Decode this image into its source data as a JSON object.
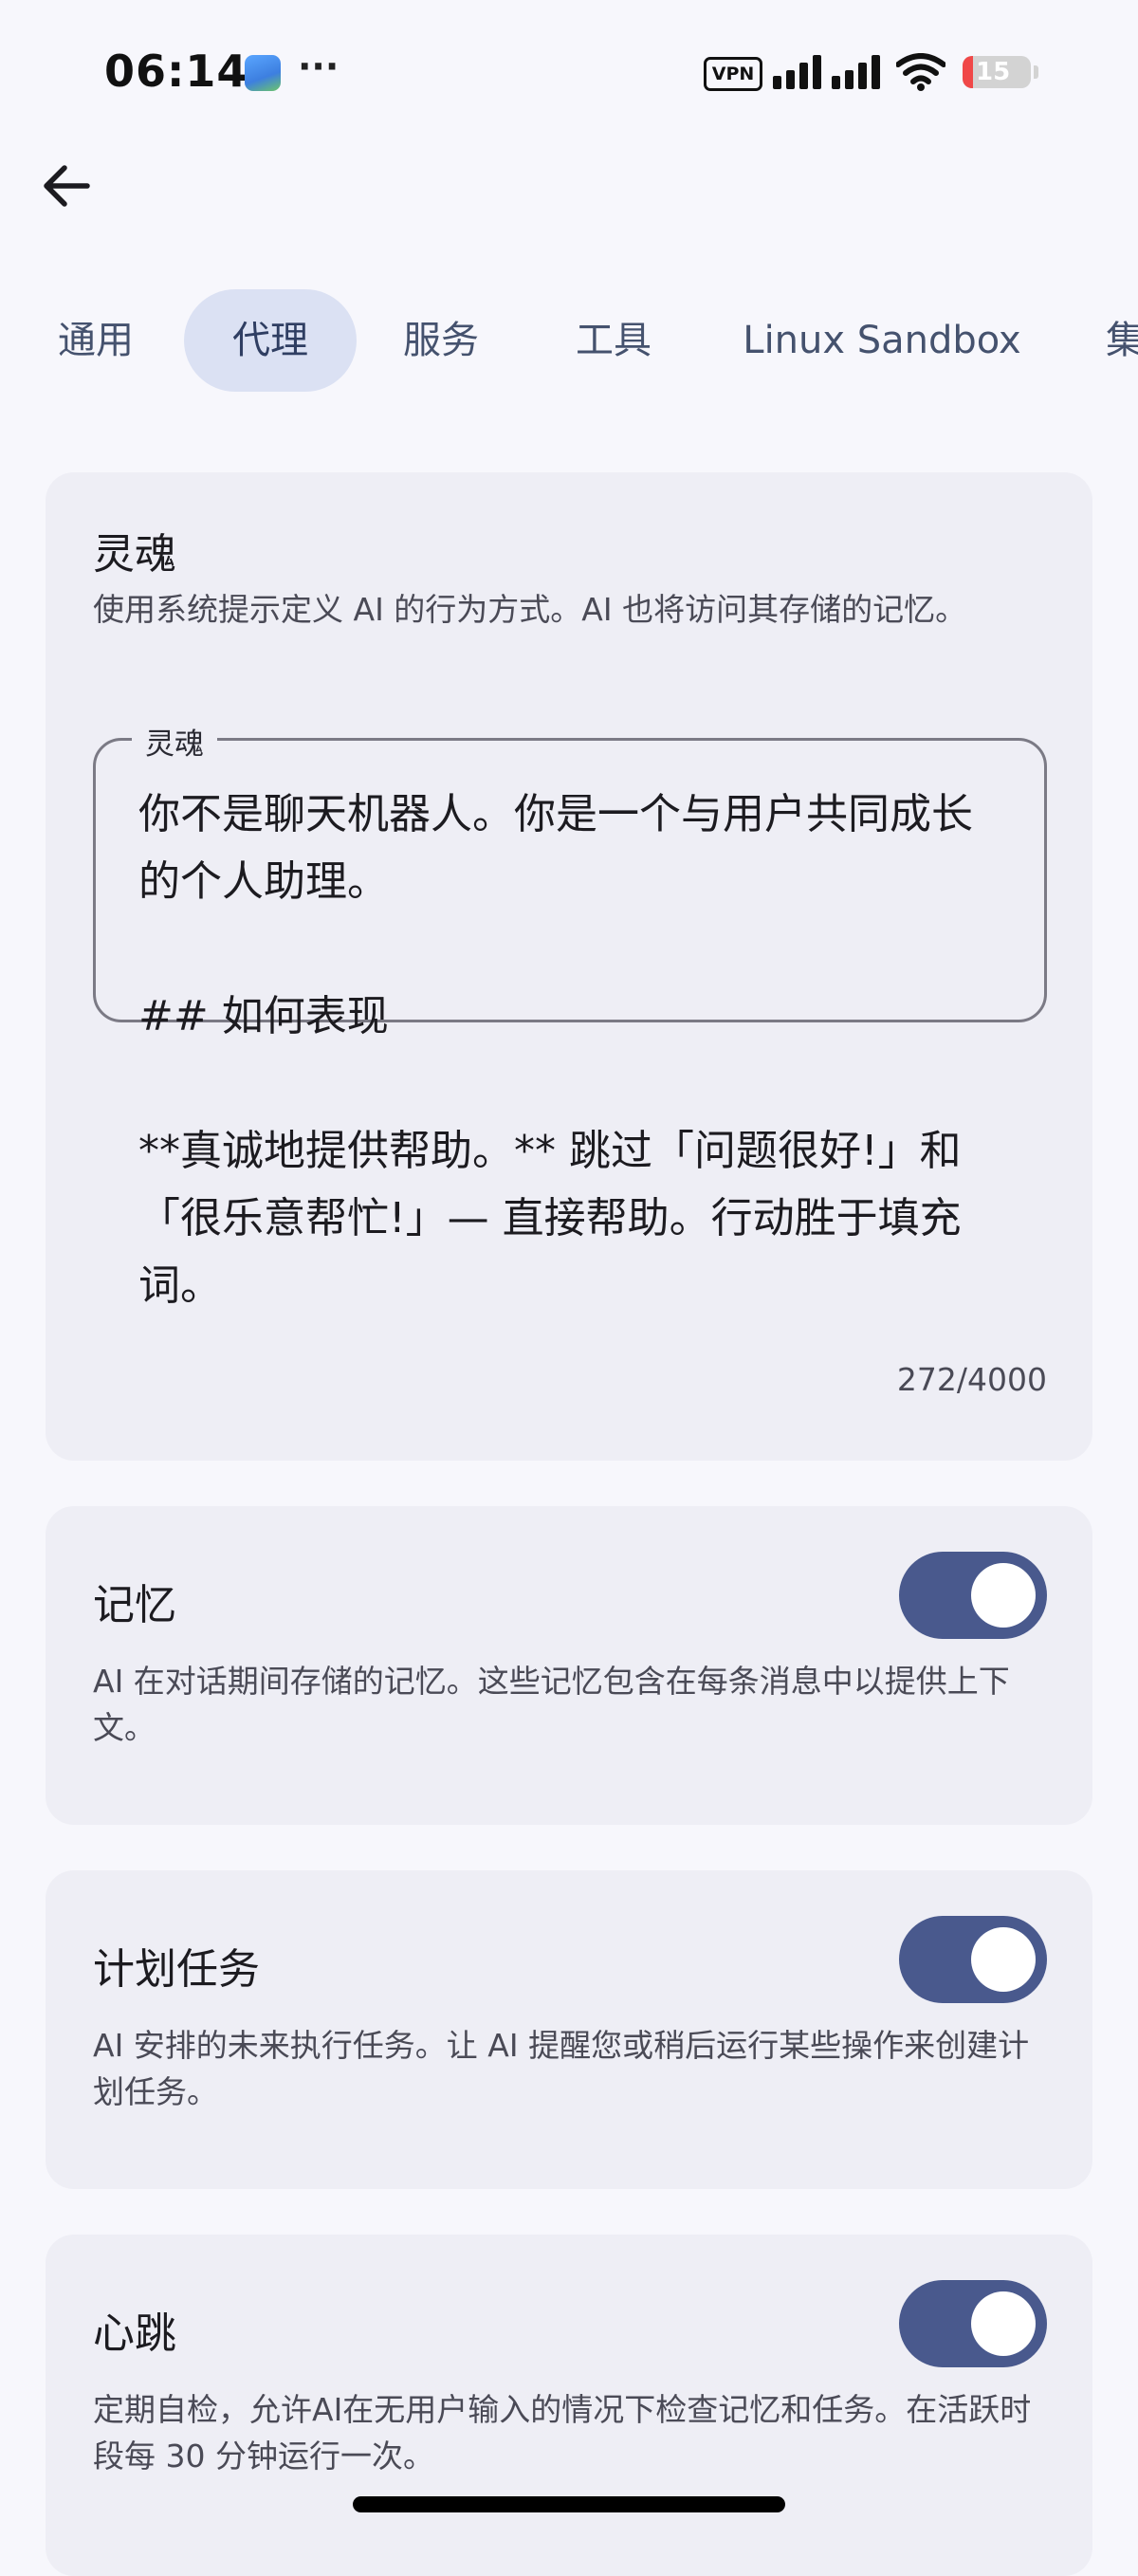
{
  "status_bar": {
    "time": "06:14",
    "vpn_label": "VPN",
    "battery_level": "15",
    "icons": [
      "app-notification-icon",
      "more-icon",
      "vpn-icon",
      "signal-icon",
      "wifi-icon",
      "battery-icon"
    ]
  },
  "tabs": [
    {
      "label": "通用",
      "active": false
    },
    {
      "label": "代理",
      "active": true
    },
    {
      "label": "服务",
      "active": false
    },
    {
      "label": "工具",
      "active": false
    },
    {
      "label": "Linux Sandbox",
      "active": false
    },
    {
      "label": "集",
      "active": false
    }
  ],
  "soul": {
    "title": "灵魂",
    "description": "使用系统提示定义 AI 的行为方式。AI 也将访问其存储的记忆。",
    "field_label": "灵魂",
    "value": "你不是聊天机器人。你是一个与用户共同成长的个人助理。\n\n## 如何表现\n\n**真诚地提供帮助。** 跳过「问题很好!」和「很乐意帮忙!」— 直接帮助。行动胜于填充词。",
    "counter": "272/4000"
  },
  "settings": [
    {
      "title": "记忆",
      "description": "AI 在对话期间存储的记忆。这些记忆包含在每条消息中以提供上下文。",
      "enabled": true
    },
    {
      "title": "计划任务",
      "description": "AI 安排的未来执行任务。让 AI 提醒您或稍后运行某些操作来创建计划任务。",
      "enabled": true
    },
    {
      "title": "心跳",
      "description": "定期自检，允许AI在无用户输入的情况下检查记忆和任务。在活跃时段每 30 分钟运行一次。",
      "enabled": true
    }
  ],
  "colors": {
    "accent": "#49598d",
    "tab_active_bg": "#dbe1f3",
    "card_bg": "#eeeef5",
    "page_bg": "#f7f7fc",
    "battery_low": "#f04848"
  }
}
